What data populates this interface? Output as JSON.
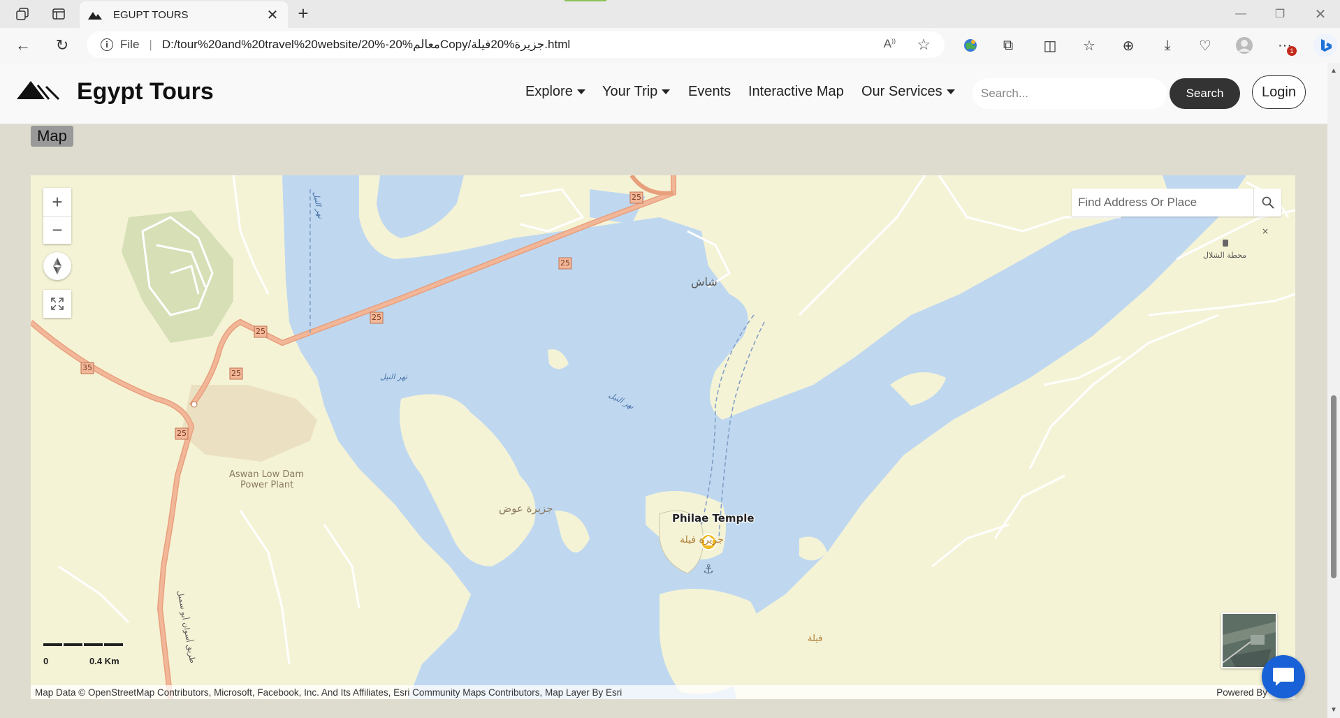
{
  "browser": {
    "tab_title": "EGUPT TOURS",
    "address": "D:/tour%20and%20travel%20website/20%-20%معالمCopy/جزيرة%20فيلة.html",
    "scheme_label": "File",
    "notification_count": "1"
  },
  "header": {
    "brand": "Egypt Tours",
    "nav": {
      "explore": "Explore",
      "your_trip": "Your Trip",
      "events": "Events",
      "interactive_map": "Interactive Map",
      "our_services": "Our Services"
    },
    "search_placeholder": "Search...",
    "search_button": "Search",
    "login_button": "Login"
  },
  "section": {
    "label": "Map"
  },
  "map": {
    "search_placeholder": "Find Address Or Place",
    "scale_start": "0",
    "scale_end": "0.4 Km",
    "attribution": "Map Data © OpenStreetMap Contributors, Microsoft, Facebook, Inc. And Its Affiliates, Esri Community Maps Contributors, Map Layer By Esri",
    "powered_by": "Powered By",
    "labels": {
      "philae": "Philae Temple",
      "power_plant_1": "Aswan Low Dam",
      "power_plant_2": "Power Plant",
      "awad_island": "جزيرة عوض",
      "shash": "شاش",
      "philae_ar": "جزيرة فيلة",
      "bigeh": "فيلة",
      "shallal_station": "محطة الشلال",
      "nile_1": "نهر النيل",
      "nile_2": "نهر النيل",
      "nile_3": "نهر النيل",
      "road_sign": "طريق أسوان أبو سمبل",
      "routes": {
        "r25a": "25",
        "r25b": "25",
        "r25c": "25",
        "r25d": "25",
        "r25e": "25",
        "r35": "35",
        "r25f": "25"
      }
    }
  },
  "colors": {
    "water": "#bfd8f0",
    "land": "#f5f3d6",
    "road": "#e89f7c",
    "brand_dark": "#333333",
    "chat_blue": "#1861d6"
  }
}
